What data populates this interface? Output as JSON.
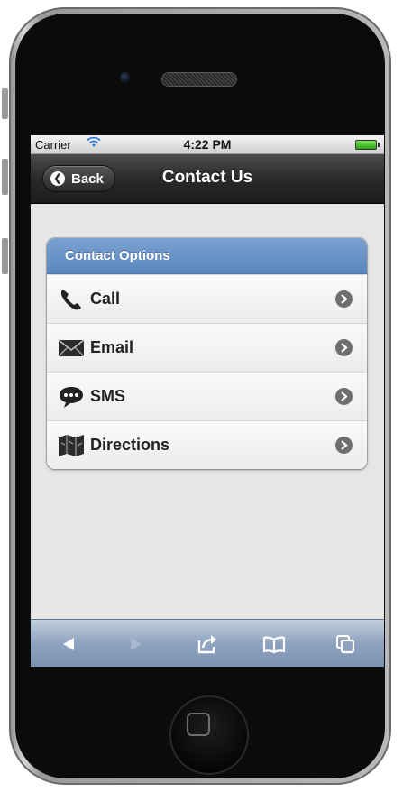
{
  "status_bar": {
    "carrier": "Carrier",
    "time": "4:22 PM"
  },
  "nav_bar": {
    "back_label": "Back",
    "title": "Contact Us"
  },
  "contact_list": {
    "header": "Contact Options",
    "items": [
      {
        "label": "Call",
        "icon": "phone-icon"
      },
      {
        "label": "Email",
        "icon": "envelope-icon"
      },
      {
        "label": "SMS",
        "icon": "chat-bubble-icon"
      },
      {
        "label": "Directions",
        "icon": "map-icon"
      }
    ]
  },
  "toolbar": {
    "buttons": [
      "back-icon",
      "forward-icon",
      "share-icon",
      "bookmarks-icon",
      "tabs-icon"
    ]
  },
  "colors": {
    "list_header": "#6a93c7",
    "nav_bar": "#2a2a2a",
    "toolbar": "#8ea3bf",
    "battery": "#3cc21f"
  }
}
